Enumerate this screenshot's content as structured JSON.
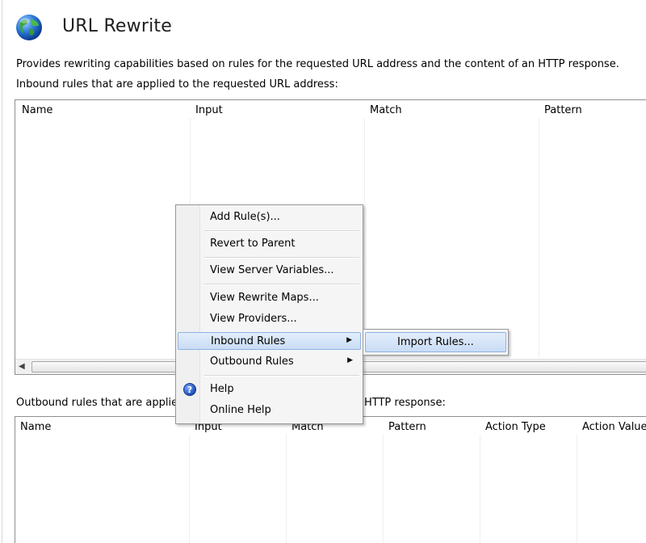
{
  "header": {
    "title": "URL Rewrite",
    "icon": "globe-icon"
  },
  "description": "Provides rewriting capabilities based on rules for the requested URL address and the content of an HTTP response.",
  "inbound": {
    "caption": "Inbound rules that are applied to the requested URL address:",
    "columns": [
      "Name",
      "Input",
      "Match",
      "Pattern"
    ]
  },
  "outbound": {
    "caption_visible_start": "Outbound rules that are applie",
    "caption_visible_end": "HTTP response:",
    "columns": [
      "Name",
      "Input",
      "Match",
      "Pattern",
      "Action Type",
      "Action Value"
    ]
  },
  "context_menu": {
    "items": [
      {
        "label": "Add Rule(s)..."
      },
      {
        "label": "Revert to Parent"
      },
      {
        "label": "View Server Variables..."
      },
      {
        "label": "View Rewrite Maps..."
      },
      {
        "label": "View Providers..."
      },
      {
        "label": "Inbound Rules",
        "has_submenu": true,
        "highlighted": true
      },
      {
        "label": "Outbound Rules",
        "has_submenu": true
      },
      {
        "label": "Help",
        "icon": "help-icon"
      },
      {
        "label": "Online Help"
      }
    ],
    "submenu": {
      "items": [
        {
          "label": "Import Rules...",
          "highlighted": true
        }
      ]
    }
  },
  "colors": {
    "highlight_bg": "#c9dcf5",
    "highlight_border": "#8fb2e0",
    "grid_border": "#8e8f8f",
    "menu_bg": "#f5f5f5"
  }
}
